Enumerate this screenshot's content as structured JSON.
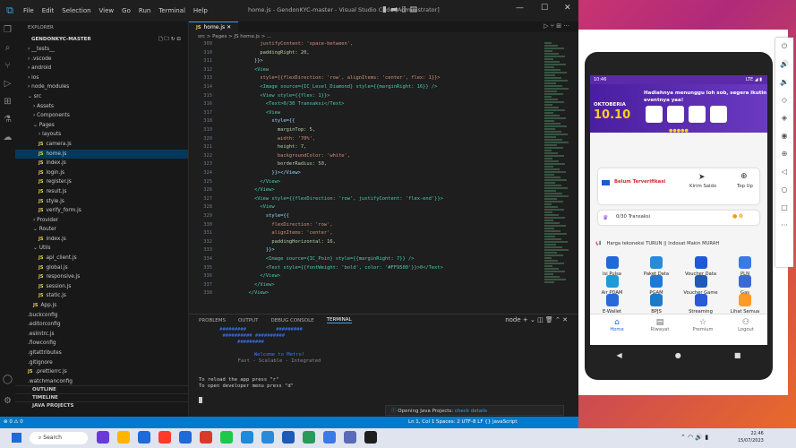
{
  "window": {
    "title": "home.js - GendonKYC-master - Visual Studio Code [Administrator]",
    "menu": [
      "File",
      "Edit",
      "Selection",
      "View",
      "Go",
      "Run",
      "Terminal",
      "Help"
    ]
  },
  "explorer": {
    "header": "EXPLORER",
    "project": "GENDONKYC-MASTER",
    "items": [
      {
        "label": "__tests__",
        "indent": 1,
        "arrow": ">",
        "js": false
      },
      {
        "label": ".vscode",
        "indent": 1,
        "arrow": ">",
        "js": false
      },
      {
        "label": "android",
        "indent": 1,
        "arrow": ">",
        "js": false
      },
      {
        "label": "ios",
        "indent": 1,
        "arrow": ">",
        "js": false
      },
      {
        "label": "node_modules",
        "indent": 1,
        "arrow": ">",
        "js": false
      },
      {
        "label": "src",
        "indent": 1,
        "arrow": "v",
        "js": false
      },
      {
        "label": "Assets",
        "indent": 2,
        "arrow": ">",
        "js": false
      },
      {
        "label": "Components",
        "indent": 2,
        "arrow": ">",
        "js": false
      },
      {
        "label": "Pages",
        "indent": 2,
        "arrow": "v",
        "js": false
      },
      {
        "label": "layouts",
        "indent": 3,
        "arrow": ">",
        "js": false
      },
      {
        "label": "camera.js",
        "indent": 3,
        "arrow": "",
        "js": true
      },
      {
        "label": "home.js",
        "indent": 3,
        "arrow": "",
        "js": true,
        "sel": true
      },
      {
        "label": "index.js",
        "indent": 3,
        "arrow": "",
        "js": true
      },
      {
        "label": "login.js",
        "indent": 3,
        "arrow": "",
        "js": true
      },
      {
        "label": "register.js",
        "indent": 3,
        "arrow": "",
        "js": true
      },
      {
        "label": "result.js",
        "indent": 3,
        "arrow": "",
        "js": true
      },
      {
        "label": "style.js",
        "indent": 3,
        "arrow": "",
        "js": true
      },
      {
        "label": "verify_form.js",
        "indent": 3,
        "arrow": "",
        "js": true
      },
      {
        "label": "Provider",
        "indent": 2,
        "arrow": ">",
        "js": false
      },
      {
        "label": "Router",
        "indent": 2,
        "arrow": "v",
        "js": false
      },
      {
        "label": "index.js",
        "indent": 3,
        "arrow": "",
        "js": true
      },
      {
        "label": "Utils",
        "indent": 2,
        "arrow": "v",
        "js": false
      },
      {
        "label": "api_client.js",
        "indent": 3,
        "arrow": "",
        "js": true
      },
      {
        "label": "global.js",
        "indent": 3,
        "arrow": "",
        "js": true
      },
      {
        "label": "responsive.js",
        "indent": 3,
        "arrow": "",
        "js": true
      },
      {
        "label": "session.js",
        "indent": 3,
        "arrow": "",
        "js": true
      },
      {
        "label": "static.js",
        "indent": 3,
        "arrow": "",
        "js": true
      },
      {
        "label": "App.js",
        "indent": 2,
        "arrow": "",
        "js": true
      },
      {
        "label": ".buckconfig",
        "indent": 1,
        "arrow": "",
        "js": false
      },
      {
        "label": ".editorconfig",
        "indent": 1,
        "arrow": "",
        "js": false
      },
      {
        "label": ".eslintrc.js",
        "indent": 1,
        "arrow": "",
        "js": false
      },
      {
        "label": ".flowconfig",
        "indent": 1,
        "arrow": "",
        "js": false
      },
      {
        "label": ".gitattributes",
        "indent": 1,
        "arrow": "",
        "js": false
      },
      {
        "label": ".gitignore",
        "indent": 1,
        "arrow": "",
        "js": false
      },
      {
        "label": ".prettierrc.js",
        "indent": 1,
        "arrow": "",
        "js": true
      },
      {
        "label": ".watchmanconfig",
        "indent": 1,
        "arrow": "",
        "js": false
      }
    ],
    "footer": [
      "OUTLINE",
      "TIMELINE",
      "JAVA PROJECTS"
    ]
  },
  "editor": {
    "tab": "home.js",
    "breadcrumb": "src > Pages > JS home.js > ...",
    "lines": [
      {
        "n": "309",
        "t": "              justifyContent: 'space-between',"
      },
      {
        "n": "310",
        "t": "              paddingRight: 20,"
      },
      {
        "n": "311",
        "t": "            }}>"
      },
      {
        "n": "312",
        "t": "            <View"
      },
      {
        "n": "313",
        "t": "              style={{flexDirection: 'row', alignItems: 'center', flex: 1}}>"
      },
      {
        "n": "314",
        "t": "              <Image source={IC_Level_Diamond} style={{marginRight: 16}} />"
      },
      {
        "n": "315",
        "t": "              <View style={{flex: 1}}>"
      },
      {
        "n": "316",
        "t": "                <Text>0/30 Transaksi</Text>"
      },
      {
        "n": "317",
        "t": "                <View"
      },
      {
        "n": "318",
        "t": "                  style={{"
      },
      {
        "n": "319",
        "t": "                    marginTop: 5,"
      },
      {
        "n": "320",
        "t": "                    width: '70%',"
      },
      {
        "n": "321",
        "t": "                    height: 7,"
      },
      {
        "n": "322",
        "t": "                    backgroundColor: 'white',"
      },
      {
        "n": "323",
        "t": "                    borderRadius: 50,"
      },
      {
        "n": "324",
        "t": "                  }}></View>"
      },
      {
        "n": "325",
        "t": "              </View>"
      },
      {
        "n": "326",
        "t": "            </View>"
      },
      {
        "n": "327",
        "t": "            <View style={{flexDirection: 'row', justifyContent: 'flex-end'}}>"
      },
      {
        "n": "328",
        "t": "              <View"
      },
      {
        "n": "329",
        "t": "                style={{"
      },
      {
        "n": "330",
        "t": "                  flexDirection: 'row',"
      },
      {
        "n": "331",
        "t": "                  alignItems: 'center',"
      },
      {
        "n": "332",
        "t": "                  paddingHorizontal: 16,"
      },
      {
        "n": "333",
        "t": "                }}>"
      },
      {
        "n": "334",
        "t": "                <Image source={IC_Poin} style={{marginRight: 7}} />"
      },
      {
        "n": "335",
        "t": "                <Text style={{fontWeight: 'bold', color: '#FF9500'}}>0</Text>"
      },
      {
        "n": "336",
        "t": "              </View>"
      },
      {
        "n": "337",
        "t": "            </View>"
      },
      {
        "n": "338",
        "t": "          </View>"
      }
    ]
  },
  "panel": {
    "tabs": [
      "PROBLEMS",
      "OUTPUT",
      "DEBUG CONSOLE",
      "TERMINAL"
    ],
    "active": "TERMINAL",
    "shell": "node",
    "banner": [
      "       #########          #########",
      "        ########## ##########",
      "             #########"
    ],
    "welcome": "Welcome to Metro!",
    "tagline": "Fast - Scalable - Integrated",
    "reload": "To reload the app press \"r\"",
    "devmenu": "To open developer menu press \"d\"",
    "toast": {
      "text": "Opening Java Projects:",
      "link": "check details"
    }
  },
  "status": {
    "left": "⊗ 0 ⚠ 0",
    "right": "Ln 1, Col 1   Spaces: 2   UTF-8   LF   {} JavaScript"
  },
  "phone": {
    "time": "10:46",
    "battery": "LTE ◢ ▮",
    "banner": {
      "title": "Hadiahnya menunggu loh sob, segera ikutin eventnya yaa!",
      "event": "OKTOBERIA",
      "event_date": "10.10"
    },
    "card1": {
      "status": "Belum Terverifikasi",
      "send": "Kirim Saldo",
      "topup": "Top Up",
      "trx": "0/30 Transaksi",
      "points": "0"
    },
    "promo": "Harga tekoneksi TURUN || Indosat Makin MURAH",
    "menu": [
      "Isi Pulsa",
      "Paket Data",
      "Voucher Data",
      "PLN",
      "Air PDAM",
      "PGAM",
      "Voucher Game",
      "Gas",
      "E-Wallet",
      "BPJS",
      "Streaming",
      "Lihat Semua"
    ],
    "nav": [
      "Home",
      "Riwayat",
      "Premium",
      "Logout"
    ]
  },
  "taskbar": {
    "search": "Search",
    "time": "22.46",
    "date": "15/07/2023"
  },
  "colors": {
    "accent": "#007acc",
    "brand": "#5a2aaa"
  }
}
